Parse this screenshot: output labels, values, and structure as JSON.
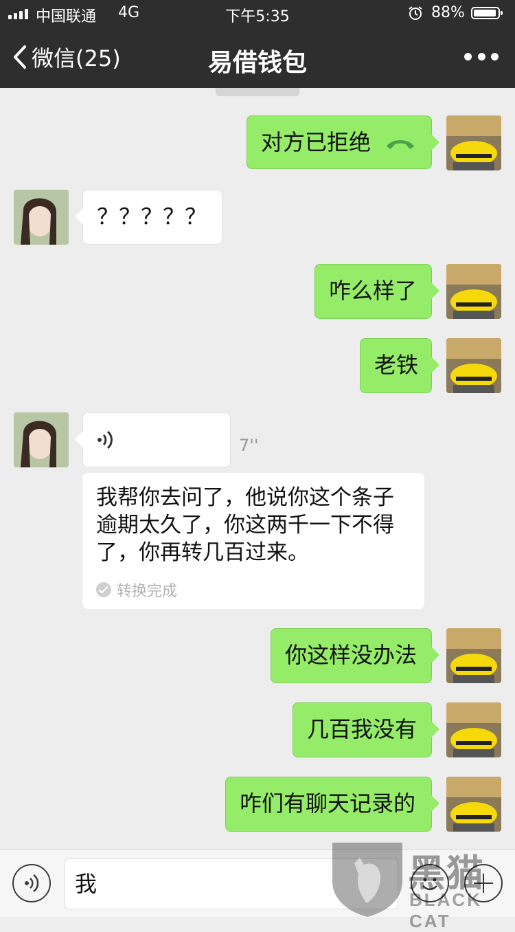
{
  "status_bar": {
    "carrier": "中国联通",
    "network": "4G",
    "time": "下午5:35",
    "battery": "88%",
    "battery_level": 0.88,
    "icons": [
      "signal-icon",
      "alarm-icon",
      "battery-icon"
    ]
  },
  "nav": {
    "back_label": "微信(25)",
    "title": "易借钱包",
    "more_icon": "more-icon",
    "back_icon": "chevron-left-icon"
  },
  "messages": [
    {
      "side": "me",
      "text": "对方已拒绝",
      "icon": "phone-hangup-icon"
    },
    {
      "side": "them",
      "text": "？？？？？"
    },
    {
      "side": "me",
      "text": "咋么样了"
    },
    {
      "side": "me",
      "text": "老铁"
    },
    {
      "side": "them",
      "type": "voice",
      "duration": "7''",
      "icon": "voice-wave-icon",
      "transcript": "我帮你去问了，他说你这个条子逾期太久了，你这两千一下不得了，你再转几百过来。",
      "transcript_status": "转换完成"
    },
    {
      "side": "me",
      "text": "你这样没办法"
    },
    {
      "side": "me",
      "text": "几百我没有"
    },
    {
      "side": "me",
      "text": "咋们有聊天记录的"
    }
  ],
  "input": {
    "value": "我",
    "voice_icon": "voice-icon",
    "emoji_icon": "emoji-icon",
    "plus_icon": "plus-icon"
  },
  "watermark": {
    "text": "黑猫",
    "sub": "BLACK CAT"
  },
  "colors": {
    "header_bg": "#2e2e2e",
    "chat_bg": "#ededed",
    "my_bubble": "#95ec69",
    "their_bubble": "#ffffff"
  }
}
